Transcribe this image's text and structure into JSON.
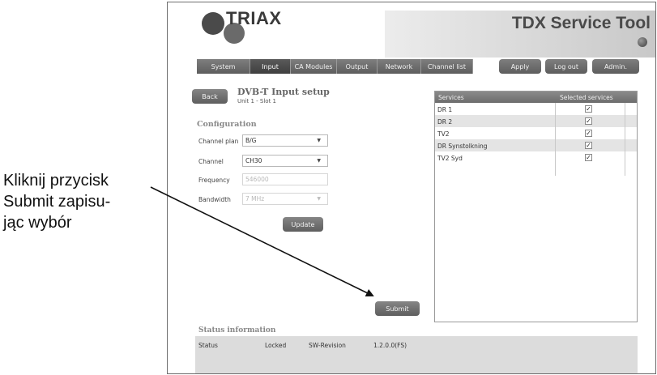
{
  "annotation": {
    "lines": [
      "Kliknij przycisk",
      "Submit zapisu-",
      "jąc wybór"
    ]
  },
  "header": {
    "logo_text": "TRIAX",
    "app_title": "TDX Service Tool"
  },
  "nav": {
    "tabs": [
      "System",
      "Input",
      "CA Modules",
      "Output",
      "Network",
      "Channel list"
    ],
    "active_tab": "Input",
    "buttons": [
      "Apply",
      "Log out",
      "Admin."
    ]
  },
  "page": {
    "back_label": "Back",
    "title": "DVB-T Input setup",
    "subtitle": "Unit 1 - Slot 1",
    "section_title": "Configuration"
  },
  "config": {
    "fields": [
      {
        "label": "Channel plan",
        "value": "B/G",
        "type": "select",
        "disabled": false
      },
      {
        "label": "Channel",
        "value": "CH30",
        "type": "select",
        "disabled": false
      },
      {
        "label": "Frequency",
        "value": "546000",
        "type": "text",
        "disabled": true
      },
      {
        "label": "Bandwidth",
        "value": "7 MHz",
        "type": "select",
        "disabled": true
      }
    ],
    "update_label": "Update",
    "submit_label": "Submit"
  },
  "services": {
    "headers": [
      "Services",
      "Selected services"
    ],
    "rows": [
      {
        "name": "DR 1",
        "selected": true
      },
      {
        "name": "DR 2",
        "selected": true
      },
      {
        "name": "TV2",
        "selected": true
      },
      {
        "name": "DR Synstolkning",
        "selected": true
      },
      {
        "name": "TV2 Syd",
        "selected": true
      }
    ]
  },
  "status": {
    "title": "Status information",
    "items": [
      "Status",
      "Locked",
      "SW-Revision",
      "1.2.0.0(FS)"
    ]
  },
  "colors": {
    "nav_bg": "#6a6a6a",
    "active_tab_bg": "#4a4a4a",
    "status_bg": "#dcdcdc",
    "row_alt": "#e4e4e4"
  }
}
